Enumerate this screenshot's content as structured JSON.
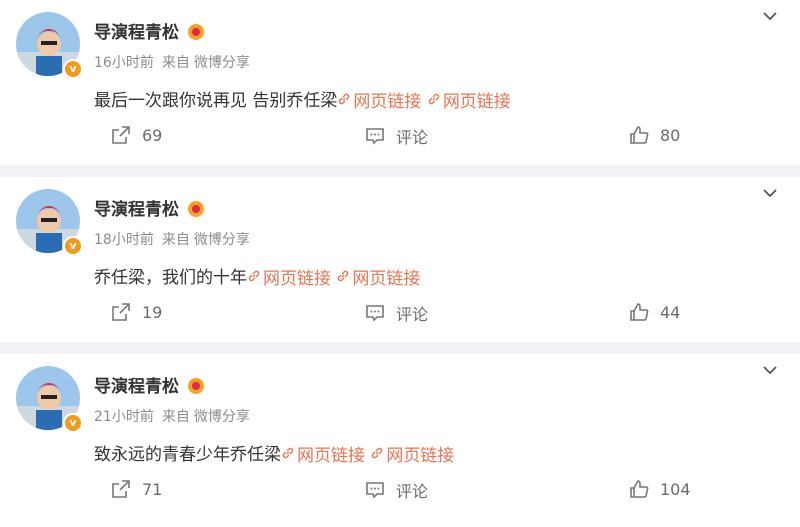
{
  "posts": [
    {
      "author": "导演程青松",
      "time": "16小时前",
      "via": "来自",
      "source": "微博分享",
      "text": "最后一次跟你说再见 告别乔任梁",
      "links": [
        "网页链接",
        "网页链接"
      ],
      "share_count": "69",
      "comment_label": "评论",
      "like_count": "80"
    },
    {
      "author": "导演程青松",
      "time": "18小时前",
      "via": "来自",
      "source": "微博分享",
      "text": "乔任梁，我们的十年",
      "links": [
        "网页链接",
        "网页链接"
      ],
      "share_count": "19",
      "comment_label": "评论",
      "like_count": "44"
    },
    {
      "author": "导演程青松",
      "time": "21小时前",
      "via": "来自",
      "source": "微博分享",
      "text": "致永远的青春少年乔任梁",
      "links": [
        "网页链接",
        "网页链接"
      ],
      "share_count": "71",
      "comment_label": "评论",
      "like_count": "104"
    }
  ],
  "verified_badge": "v",
  "colors": {
    "link": "#eb7350",
    "badge": "#f39a1a",
    "divider": "#f1f2f5"
  }
}
